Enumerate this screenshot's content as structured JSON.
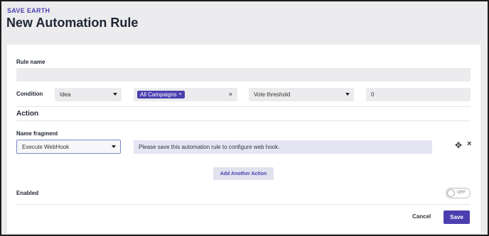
{
  "header": {
    "org_name": "SAVE EARTH",
    "page_title": "New Automation Rule"
  },
  "form": {
    "rule_name_label": "Rule name",
    "rule_name_value": "",
    "condition_label": "Condition",
    "condition_type": "Idea",
    "campaign_chip": "All Campaigns",
    "chip_remove": "×",
    "clear": "×",
    "threshold_type": "Vote threshold",
    "threshold_value": "0"
  },
  "action": {
    "section_title": "Action",
    "fragment_label": "Name fragment",
    "fragment_value": "Execute WebHook",
    "info_text": "Please save this automation rule to configure web hook.",
    "move_icon": "✥",
    "remove_icon": "×",
    "add_button": "Add Another Action"
  },
  "enabled": {
    "label": "Enabled",
    "toggle_text": "OFF",
    "is_on": false
  },
  "footer": {
    "cancel_label": "Cancel",
    "save_label": "Save"
  },
  "colors": {
    "accent": "#4b3fb0",
    "background": "#ececee",
    "field": "#ececee",
    "info_box": "#e6e5f3"
  }
}
